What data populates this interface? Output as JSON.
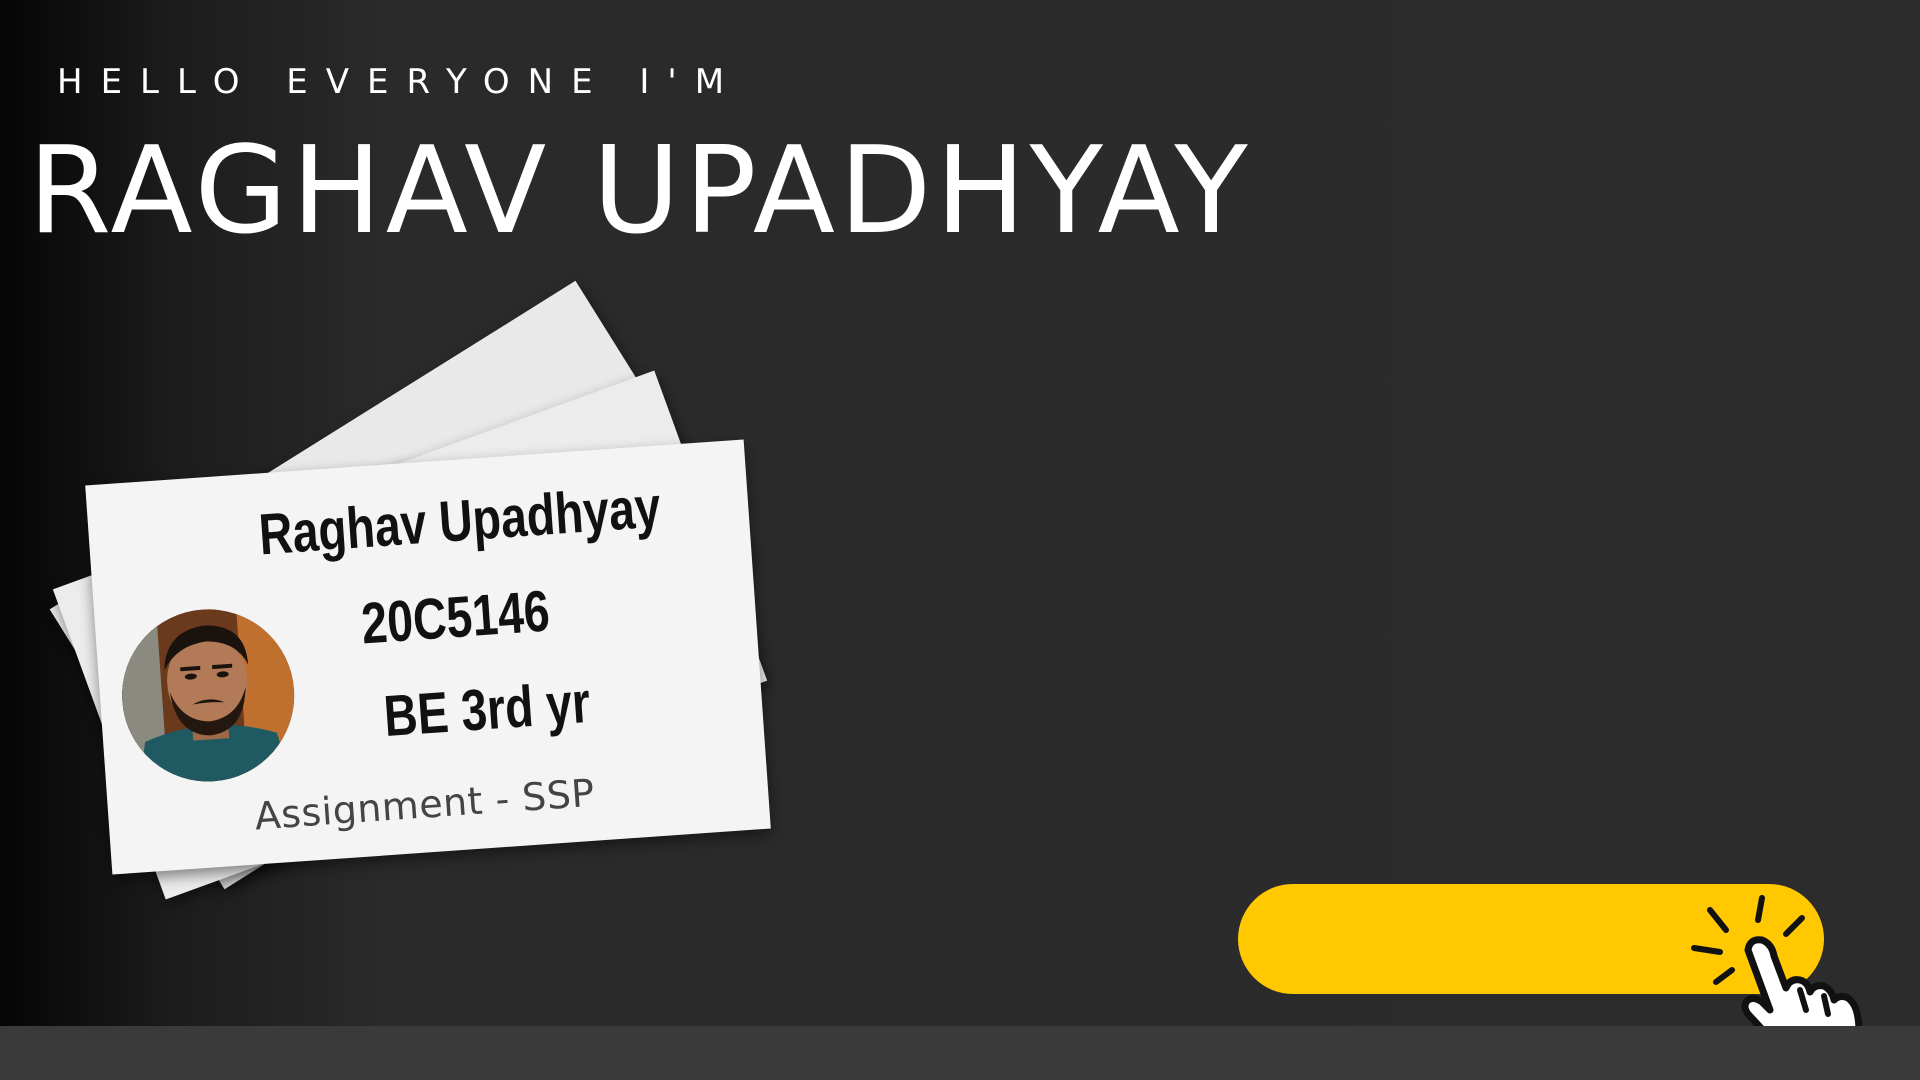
{
  "header": {
    "greeting": "HELLO EVERYONE I'M",
    "name": "RAGHAV UPADHYAY"
  },
  "card": {
    "name": "Raghav Upadhyay",
    "id": "20C5146",
    "year": "BE 3rd yr",
    "assignment": "Assignment - SSP",
    "avatar_icon": "profile-photo"
  },
  "cta": {
    "label": "",
    "icon": "pointing-hand-click-icon",
    "color": "#ffc800"
  },
  "colors": {
    "background": "#2c2c2c",
    "text": "#ffffff",
    "accent": "#ffc800"
  }
}
